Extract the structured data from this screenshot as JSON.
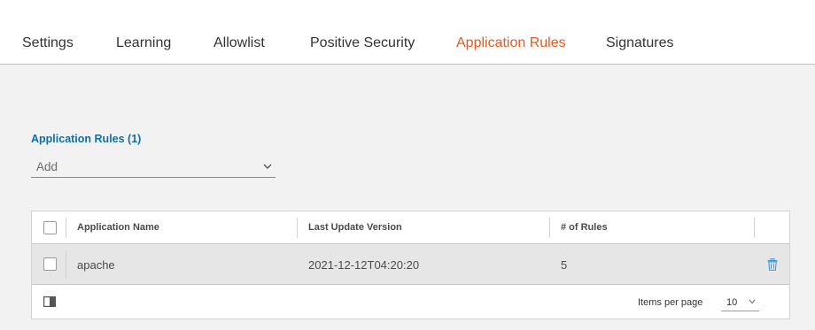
{
  "tabs": [
    {
      "label": "Settings",
      "active": false
    },
    {
      "label": "Learning",
      "active": false
    },
    {
      "label": "Allowlist",
      "active": false
    },
    {
      "label": "Positive Security",
      "active": false
    },
    {
      "label": "Application Rules",
      "active": true
    },
    {
      "label": "Signatures",
      "active": false
    }
  ],
  "section": {
    "title": "Application Rules (1)",
    "add_label": "Add"
  },
  "grid": {
    "columns": [
      "Application Name",
      "Last Update Version",
      "# of Rules"
    ],
    "rows": [
      {
        "name": "apache",
        "version": "2021-12-12T04:20:20",
        "rules": "5",
        "selected": false
      }
    ],
    "footer": {
      "items_per_page_label": "Items per page",
      "items_per_page_value": "10"
    }
  },
  "colors": {
    "accent": "#e8581e",
    "link_blue": "#0f6fa6",
    "trash_icon": "#4a9ad4"
  },
  "icons": [
    "chevron-down-icon",
    "trash-icon",
    "column-toggle-icon"
  ]
}
